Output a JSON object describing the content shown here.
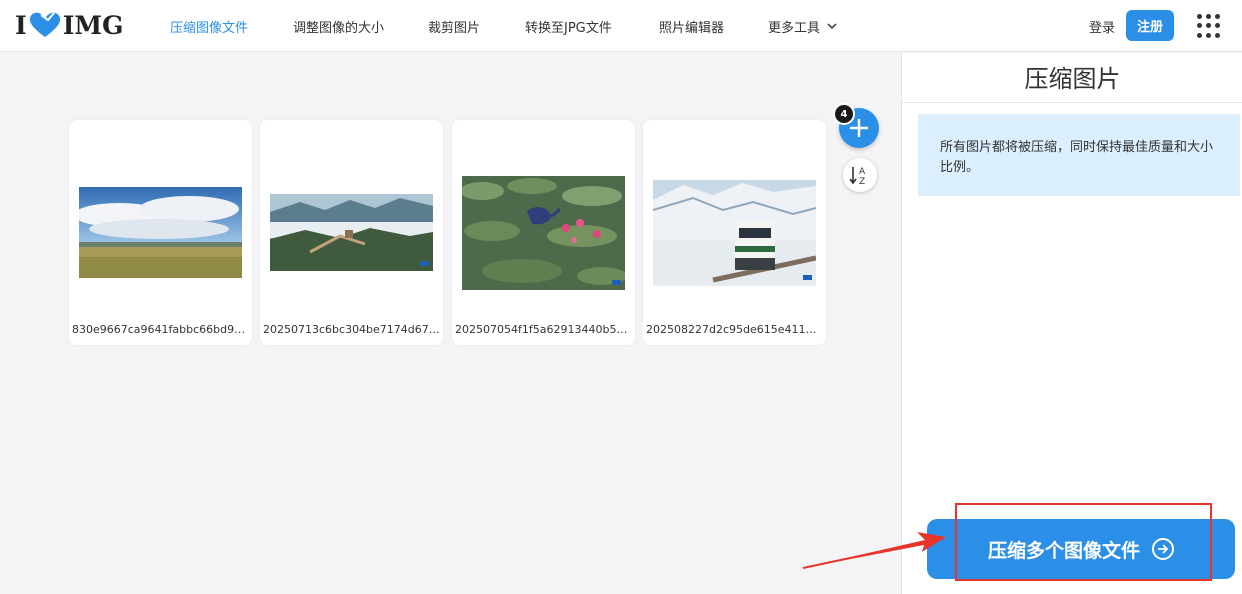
{
  "header": {
    "logo_left": "I",
    "logo_right": "IMG",
    "nav": [
      {
        "label": "压缩图像文件"
      },
      {
        "label": "调整图像的大小"
      },
      {
        "label": "裁剪图片"
      },
      {
        "label": "转换至JPG文件"
      },
      {
        "label": "照片编辑器"
      },
      {
        "label": "更多工具"
      }
    ],
    "login": "登录",
    "register": "注册"
  },
  "workspace": {
    "file_count": "4",
    "add_symbol": "+",
    "files": [
      {
        "name": "830e9667ca9641fabbc66bd96d…"
      },
      {
        "name": "20250713c6bc304be7174d67b0…"
      },
      {
        "name": "202507054f1f5a62913440b58ee…"
      },
      {
        "name": "202508227d2c95de615e411b96…"
      }
    ]
  },
  "sidebar": {
    "title": "压缩图片",
    "info": "所有图片都将被压缩，同时保持最佳质量和大小比例。",
    "action_button": "压缩多个图像文件"
  },
  "colors": {
    "accent": "#2b8fe7",
    "info_bg": "#dcefff",
    "annotation": "#e8352a",
    "logo_heart": "#2b8fe7"
  },
  "icons": [
    "heart-logo-icon",
    "chevron-down-icon",
    "apps-grid-icon",
    "plus-icon",
    "sort-az-icon",
    "arrow-right-circle-icon"
  ]
}
